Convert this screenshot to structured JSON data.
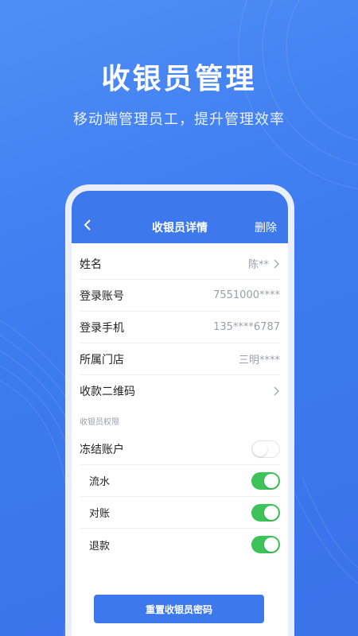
{
  "hero": {
    "title": "收银员管理",
    "subtitle": "移动端管理员工，提升管理效率"
  },
  "navbar": {
    "back_icon": "chevron-left-icon",
    "title": "收银员详情",
    "delete_label": "删除"
  },
  "details": [
    {
      "label": "姓名",
      "value": "陈**",
      "chevron": true
    },
    {
      "label": "登录账号",
      "value": "7551000****",
      "chevron": false
    },
    {
      "label": "登录手机",
      "value": "135****6787",
      "chevron": false
    },
    {
      "label": "所属门店",
      "value": "三明****",
      "chevron": false
    },
    {
      "label": "收款二维码",
      "value": "",
      "chevron": true
    }
  ],
  "permissions": {
    "section_title": "收银员权限",
    "freeze": {
      "label": "冻结账户",
      "on": false
    },
    "items": [
      {
        "label": "流水",
        "on": true
      },
      {
        "label": "对账",
        "on": true
      },
      {
        "label": "退款",
        "on": true
      }
    ]
  },
  "reset_button": {
    "label": "重置收银员密码"
  },
  "colors": {
    "primary": "#3d78ec",
    "toggle_on": "#3ec25a",
    "background": "#4f8df6"
  }
}
